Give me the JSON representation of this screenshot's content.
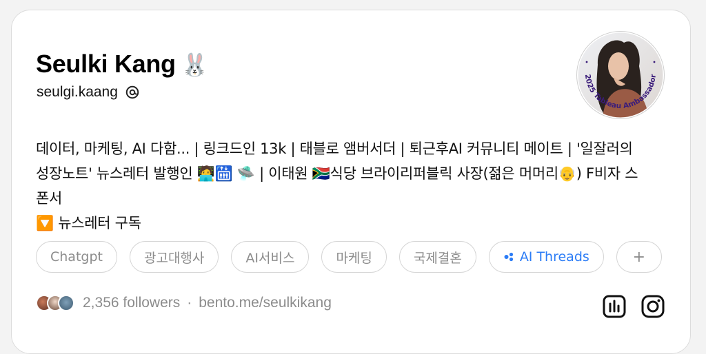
{
  "profile": {
    "display_name": "Seulki Kang",
    "name_emoji": "🐰",
    "handle": "seulgi.kaang",
    "avatar_badge_text": "2025 Tableau Ambassador"
  },
  "bio": {
    "line1": "데이터, 마케팅, AI 다함... | 링크드인 13k | 태블로 앰버서더 | 퇴근후AI 커뮤니티 메이트 | '일잘러의",
    "line2": "성장노트' 뉴스레터 발행인 🧑‍💻🛗 🛸 | 이태원 🇿🇦식당 브라이리퍼블릭 사장(젊은 머머리👴) F비자 스",
    "line3": "폰서",
    "line4": "🔽 뉴스레터 구독"
  },
  "tags": [
    {
      "label": "Chatgpt"
    },
    {
      "label": "광고대행사"
    },
    {
      "label": "AI서비스"
    },
    {
      "label": "마케팅"
    },
    {
      "label": "국제결혼"
    },
    {
      "label": "AI Threads"
    },
    {
      "label": "+"
    }
  ],
  "footer": {
    "followers": "2,356 followers",
    "separator": "·",
    "link": "bento.me/seulkikang"
  },
  "icons": {
    "handle_icon": "threads-icon",
    "insights": "bar-chart-icon",
    "instagram": "instagram-icon"
  },
  "colors": {
    "accent": "#2b7cf6",
    "muted": "#8c8c8c",
    "badge_ring": "#3a1c7a"
  }
}
